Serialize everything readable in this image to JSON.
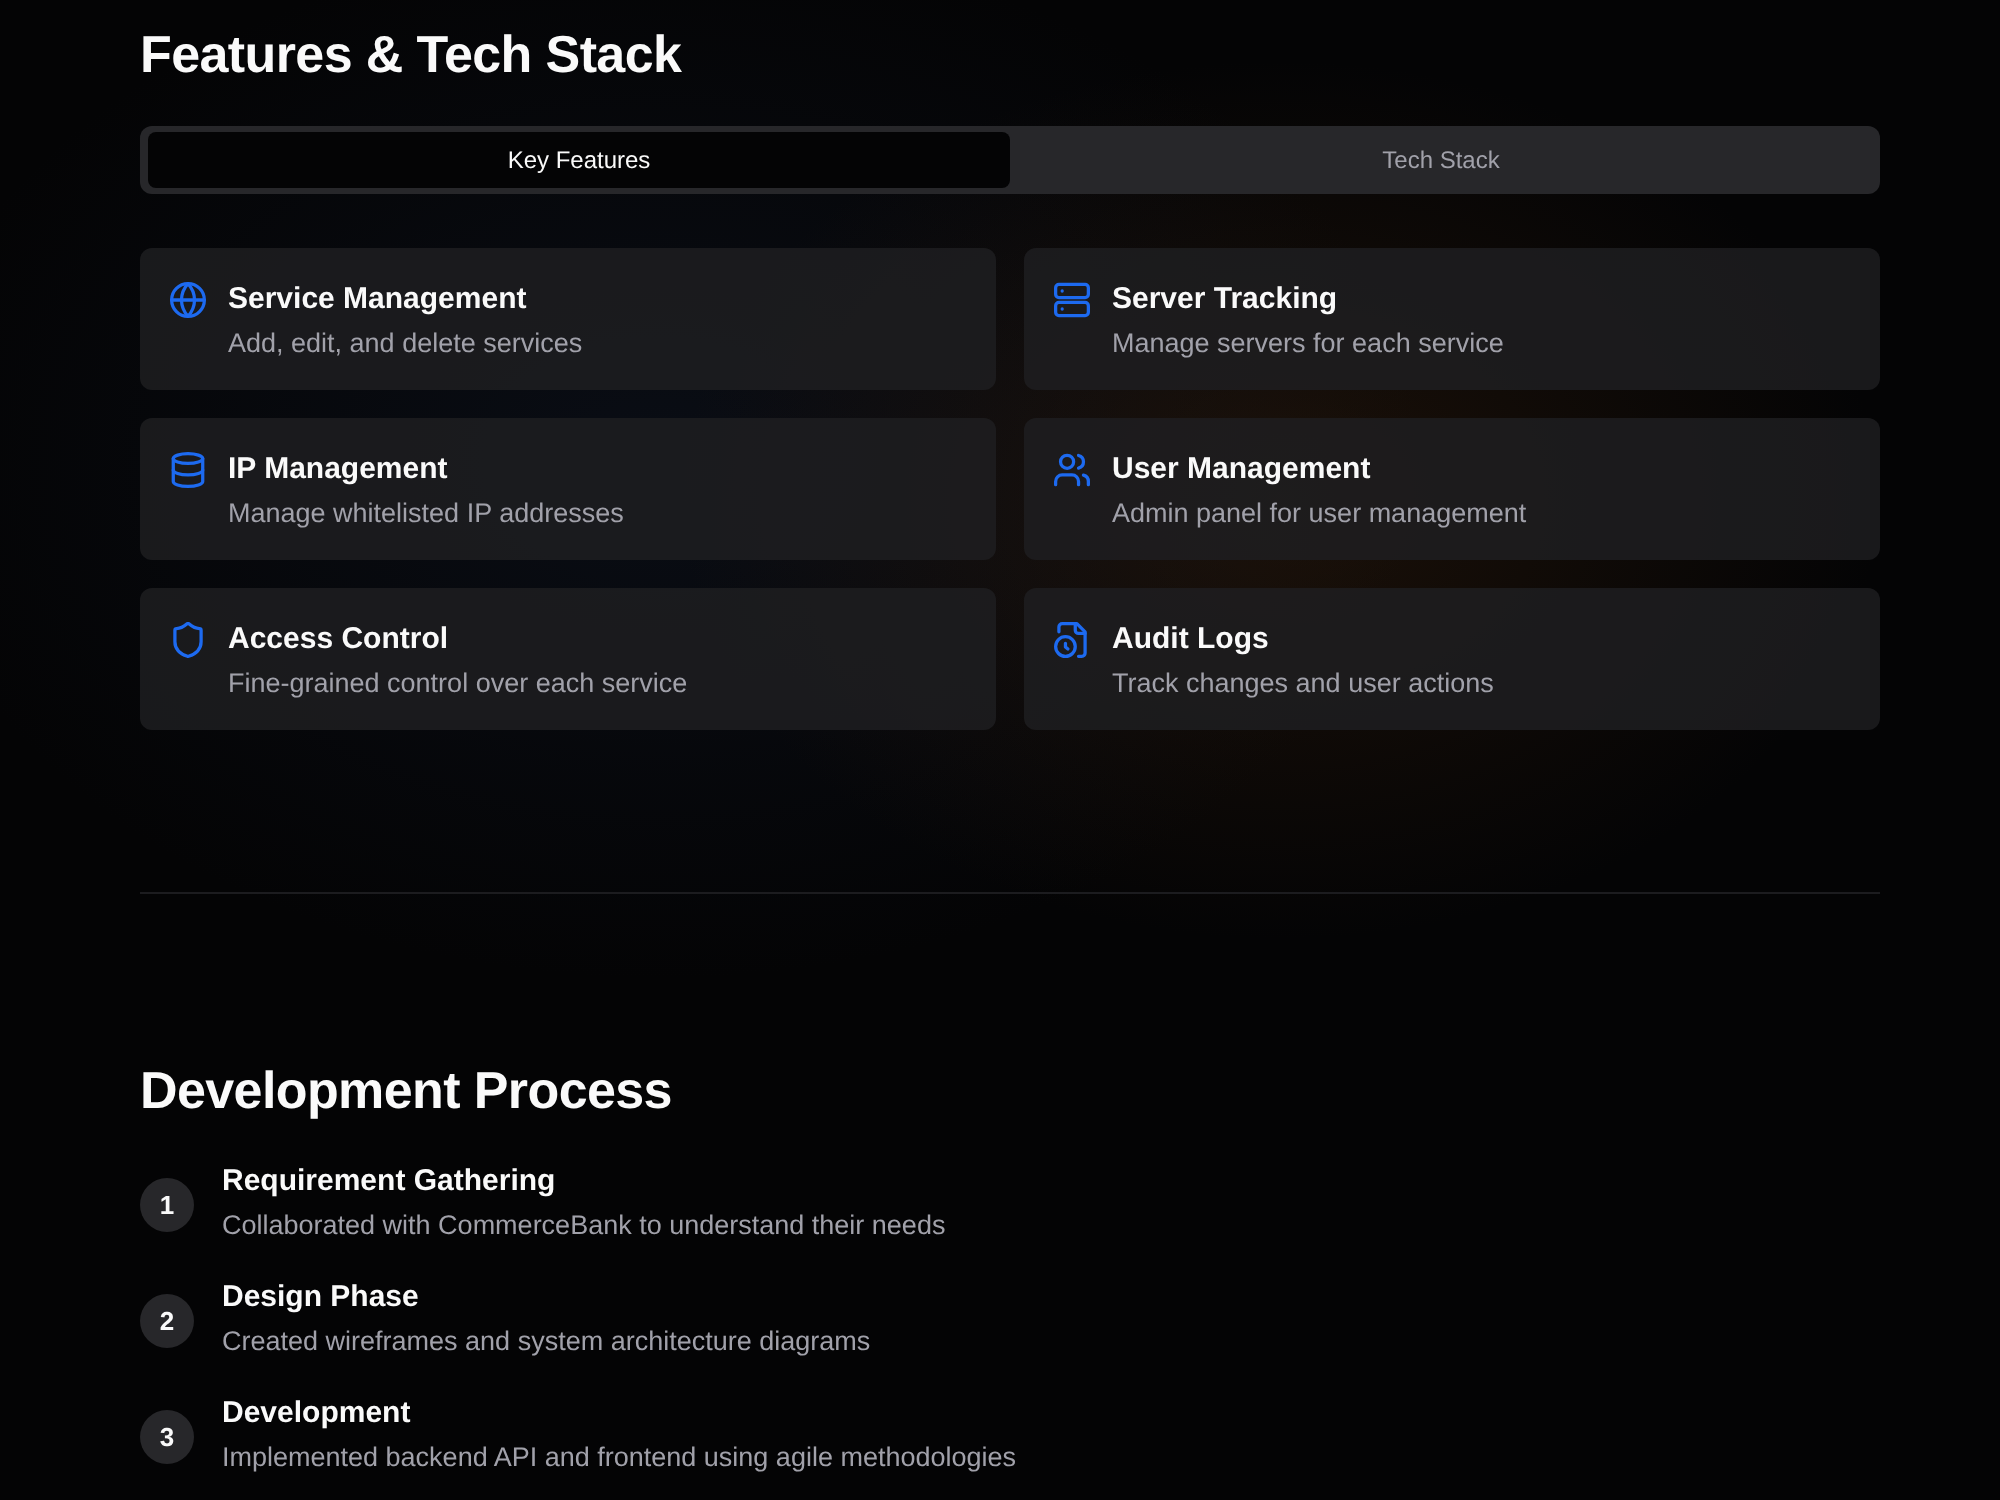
{
  "features_section": {
    "title": "Features & Tech Stack",
    "tabs": [
      {
        "label": "Key Features",
        "selected": true
      },
      {
        "label": "Tech Stack",
        "selected": false
      }
    ],
    "features": [
      {
        "title": "Service Management",
        "description": "Add, edit, and delete services"
      },
      {
        "title": "Server Tracking",
        "description": "Manage servers for each service"
      },
      {
        "title": "IP Management",
        "description": "Manage whitelisted IP addresses"
      },
      {
        "title": "User Management",
        "description": "Admin panel for user management"
      },
      {
        "title": "Access Control",
        "description": "Fine-grained control over each service"
      },
      {
        "title": "Audit Logs",
        "description": "Track changes and user actions"
      }
    ]
  },
  "process_section": {
    "title": "Development Process",
    "steps": [
      {
        "number": "1",
        "title": "Requirement Gathering",
        "description": "Collaborated with CommerceBank to understand their needs"
      },
      {
        "number": "2",
        "title": "Design Phase",
        "description": "Created wireframes and system architecture diagrams"
      },
      {
        "number": "3",
        "title": "Development",
        "description": "Implemented backend API and frontend using agile methodologies"
      }
    ]
  }
}
